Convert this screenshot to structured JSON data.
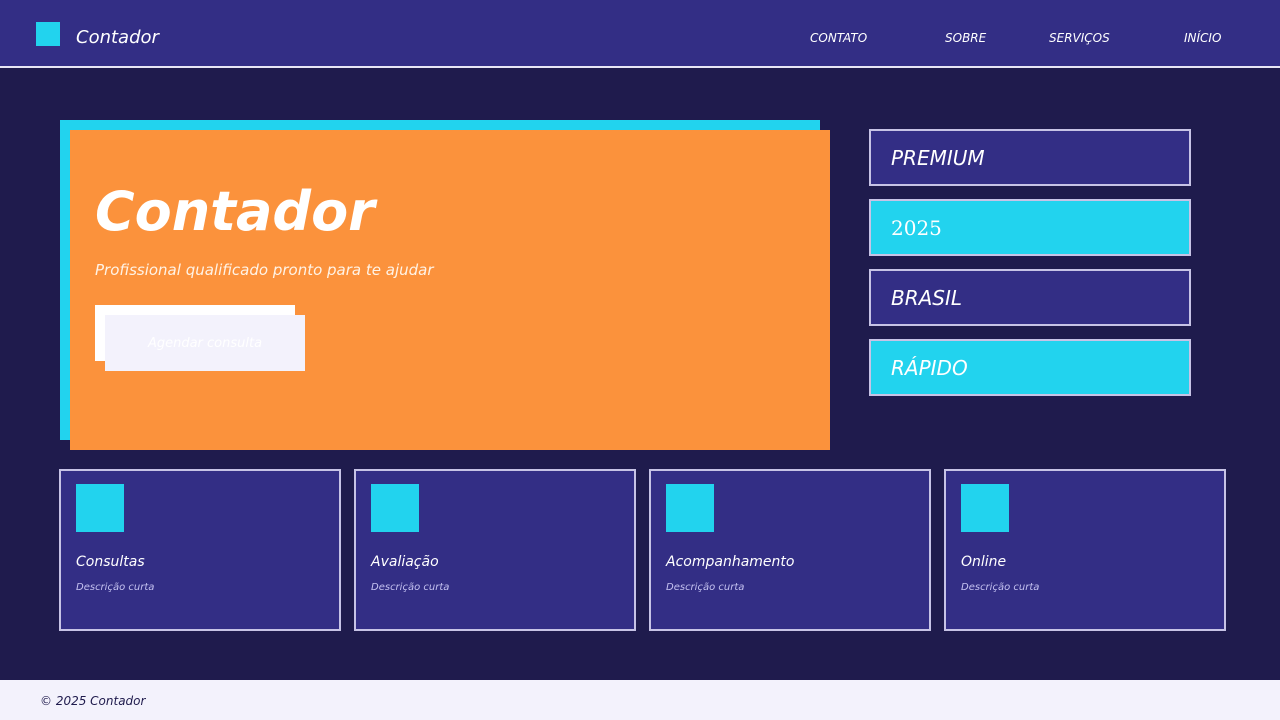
{
  "header": {
    "brand": "Contador",
    "nav": [
      "CONTATO",
      "SOBRE",
      "SERVIÇOS",
      "INÍCIO"
    ]
  },
  "hero": {
    "title": "Contador",
    "subtitle": "Profissional qualificado pronto para te ajudar",
    "cta_label": "Agendar consulta"
  },
  "tags": [
    "PREMIUM",
    "2025",
    "BRASIL",
    "RÁPIDO"
  ],
  "cards": [
    {
      "title": "Consultas",
      "description": "Descrição curta"
    },
    {
      "title": "Avaliação",
      "description": "Descrição curta"
    },
    {
      "title": "Acompanhamento",
      "description": "Descrição curta"
    },
    {
      "title": "Online",
      "description": "Descrição curta"
    }
  ],
  "footer": {
    "text": "© 2025 Contador"
  },
  "colors": {
    "background": "#1f1b4d",
    "primary": "#332e85",
    "accent_cyan": "#22d3ee",
    "accent_orange": "#fb923c",
    "light": "#f3f2fc"
  },
  "icons": {
    "logo": "square-logo-icon",
    "card": "square-card-icon"
  }
}
